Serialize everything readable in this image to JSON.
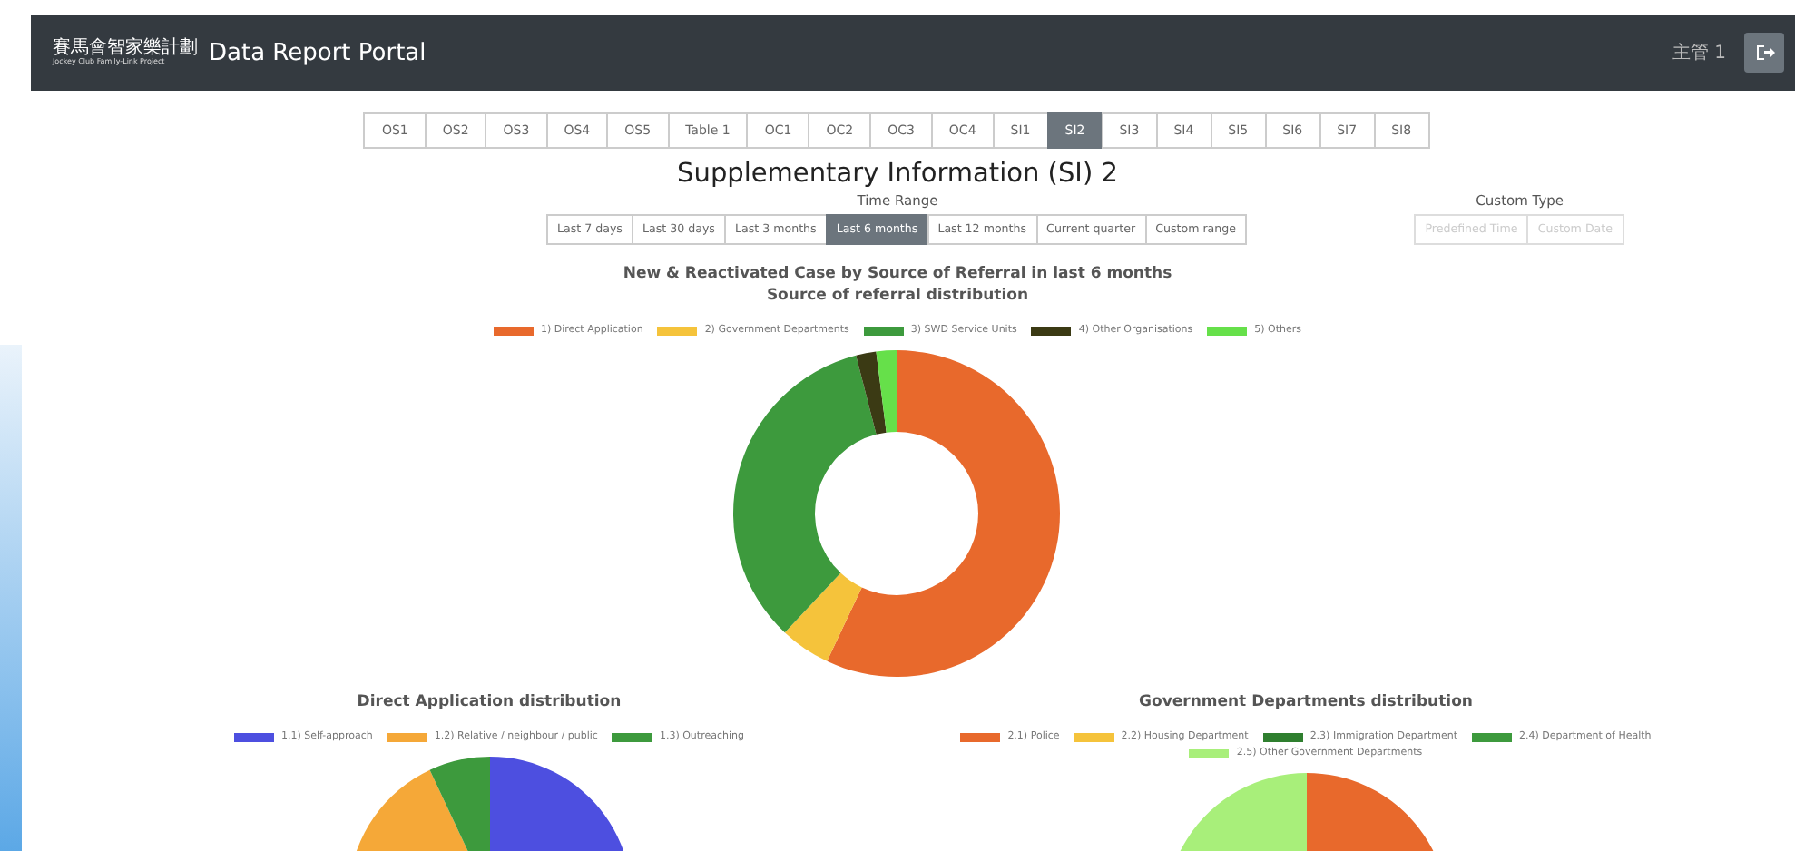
{
  "header": {
    "logo_chinese": "賽馬會智家樂計劃",
    "logo_english": "Jockey Club Family-Link Project",
    "title": "Data Report Portal",
    "user": "主管 1"
  },
  "tabs": [
    {
      "label": "OS1",
      "selected": false
    },
    {
      "label": "OS2",
      "selected": false
    },
    {
      "label": "OS3",
      "selected": false
    },
    {
      "label": "OS4",
      "selected": false
    },
    {
      "label": "OS5",
      "selected": false
    },
    {
      "label": "Table 1",
      "selected": false
    },
    {
      "label": "OC1",
      "selected": false
    },
    {
      "label": "OC2",
      "selected": false
    },
    {
      "label": "OC3",
      "selected": false
    },
    {
      "label": "OC4",
      "selected": false
    },
    {
      "label": "SI1",
      "selected": false
    },
    {
      "label": "SI2",
      "selected": true
    },
    {
      "label": "SI3",
      "selected": false
    },
    {
      "label": "SI4",
      "selected": false
    },
    {
      "label": "SI5",
      "selected": false
    },
    {
      "label": "SI6",
      "selected": false
    },
    {
      "label": "SI7",
      "selected": false
    },
    {
      "label": "SI8",
      "selected": false
    }
  ],
  "page_title": "Supplementary Information (SI) 2",
  "time_range": {
    "label": "Time Range",
    "options": [
      {
        "label": "Last 7 days",
        "selected": false
      },
      {
        "label": "Last 30 days",
        "selected": false
      },
      {
        "label": "Last 3 months",
        "selected": false
      },
      {
        "label": "Last 6 months",
        "selected": true
      },
      {
        "label": "Last 12 months",
        "selected": false
      },
      {
        "label": "Current quarter",
        "selected": false
      },
      {
        "label": "Custom range",
        "selected": false
      }
    ]
  },
  "custom_type": {
    "label": "Custom Type",
    "options": [
      {
        "label": "Predefined Time",
        "disabled": true
      },
      {
        "label": "Custom Date",
        "disabled": true
      }
    ]
  },
  "charts": [
    {
      "title": "New & Reactivated Case by Source of Referral in last 6 months",
      "subtitle": "Source of referral distribution",
      "kind": "donut",
      "legend": [
        {
          "label": "1) Direct Application",
          "color": "#e8692c"
        },
        {
          "label": "2) Government Departments",
          "color": "#f5c33b"
        },
        {
          "label": "3) SWD Service Units",
          "color": "#3d9a3d"
        },
        {
          "label": "4) Other Organisations",
          "color": "#3b3a14"
        },
        {
          "label": "5) Others",
          "color": "#66e04a"
        }
      ]
    },
    {
      "title": "Direct Application distribution",
      "kind": "pie",
      "legend": [
        {
          "label": "1.1) Self-approach",
          "color": "#4d4fe0"
        },
        {
          "label": "1.2) Relative / neighbour / public",
          "color": "#f5a838"
        },
        {
          "label": "1.3) Outreaching",
          "color": "#3d9a3d"
        }
      ]
    },
    {
      "title": "Government Departments distribution",
      "kind": "pie",
      "legend": [
        {
          "label": "2.1) Police",
          "color": "#e8692c"
        },
        {
          "label": "2.2) Housing Department",
          "color": "#f5c33b"
        },
        {
          "label": "2.3) Immigration Department",
          "color": "#2f7f2f"
        },
        {
          "label": "2.4) Department of Health",
          "color": "#3d9a3d"
        },
        {
          "label": "2.5) Other Government Departments",
          "color": "#a8ef7a"
        }
      ]
    }
  ]
}
